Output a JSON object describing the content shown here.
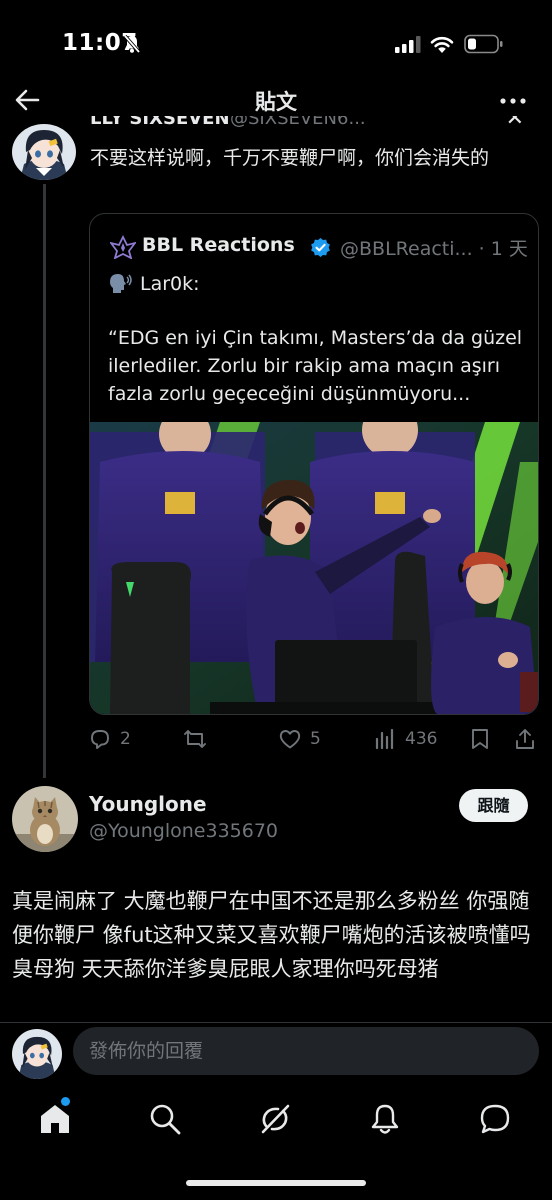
{
  "status_bar": {
    "time": "11:07"
  },
  "nav": {
    "title": "貼文"
  },
  "parent_tweet": {
    "name_partial": "LLY SIXSEVEN",
    "handle_partial": "@SIXSEVEN6...",
    "text": "不要这样说啊，千万不要鞭尸啊，你们会消失的",
    "quoted_tweet": {
      "display_name": "BBL Reactions",
      "handle_time": "@BBLReacti... · 1 天",
      "speaker": "Lar0k:",
      "text": "“EDG en iyi Çin takımı, Masters’da da güzel ilerlediler. Zorlu bir rakip ama maçın aşırı fazla zorlu geçeceğini düşünmüyoru..."
    },
    "actions": {
      "replies": "2",
      "retweets": "",
      "likes": "5",
      "views": "436"
    }
  },
  "reply": {
    "display_name": "Younglone",
    "handle": "@Younglone335670",
    "follow_label": "跟隨",
    "text": "真是闹麻了 大魔也鞭尸在中国不还是那么多粉丝 你强随便你鞭尸 像fut这种又菜又喜欢鞭尸嘴炮的活该被喷懂吗臭母狗 天天舔你洋爹臭屁眼人家理你吗死母猪"
  },
  "compose": {
    "placeholder": "發佈你的回覆"
  },
  "colors": {
    "background": "#000000",
    "text": "#e7e9ea",
    "secondary": "#71767b",
    "accent": "#1d9bf0",
    "border": "#2f3336"
  },
  "icons": {
    "tabs": [
      "home-icon",
      "search-icon",
      "grok-icon",
      "notifications-icon",
      "messages-icon"
    ],
    "actions": [
      "reply-icon",
      "retweet-icon",
      "like-icon",
      "views-icon",
      "bookmark-icon",
      "share-icon"
    ]
  }
}
